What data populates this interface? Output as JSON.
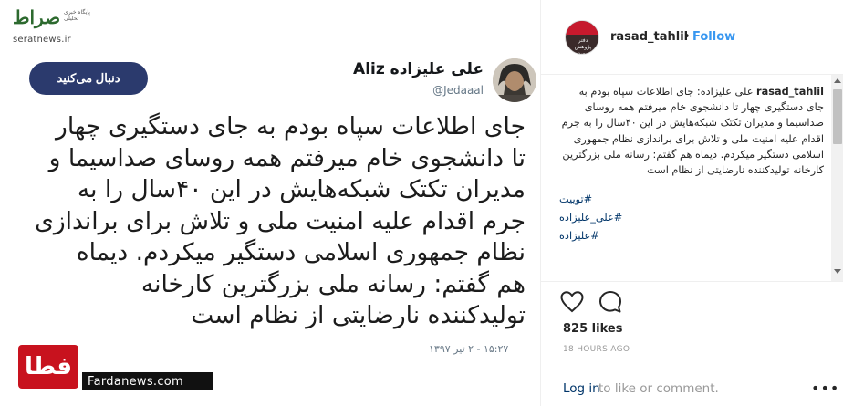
{
  "watermark_top": {
    "logo": "صراط",
    "tagline": "پایگاه خبری تحلیلی",
    "site": "seratnews.ir"
  },
  "tweet": {
    "author_name": "علی علیزاده Aliz",
    "author_handle": "@Jedaaal",
    "follow_label": "دنبال می‌کنید",
    "lines": [
      "جای اطلاعات سپاه بودم به جای دستگیری چهار",
      "تا دانشجوی خام میرفتم همه روسای صداسیما و",
      "مدیران تکتک شبکه‌هایش در این ۴۰سال را به",
      "جرم اقدام علیه امنیت ملی و تلاش برای براندازی",
      "نظام جمهوری اسلامی دستگیر میکردم. دیماه",
      "هم گفتم: رسانه ملی بزرگترین کارخانه",
      "تولیدکننده نارضایتی از نظام است"
    ],
    "date": "۱۵:۲۷ - ۲ تیر ۱۳۹۷"
  },
  "watermark_bottom": {
    "logo": "فطا",
    "site": "Fardanews.com"
  },
  "side": {
    "username": "rasad_tahlil",
    "separator": "•",
    "follow": "Follow",
    "avatar_text": "دفتر پژوهش رصد",
    "caption_user": "rasad_tahlil",
    "caption_text": "علی علیزاده: جای اطلاعات سپاه بودم به جای دستگیری چهار تا دانشجوی خام میرفتم همه روسای صداسیما و مدیران تکتک شبکه‌هایش در این ۴۰سال را به جرم اقدام علیه امنیت ملی و تلاش برای براندازی نظام جمهوری اسلامی دستگیر میکردم. دیماه هم گفتم: رسانه ملی بزرگترین کارخانه تولیدکننده نارضایتی از نظام است",
    "hashtags": [
      "#توییت",
      "#علی_علیزاده",
      "#علیزاده"
    ],
    "likes": "825 likes",
    "time_ago": "18 HOURS AGO",
    "login_link": "Log in",
    "login_rest": "to like or comment.",
    "more": "•••"
  },
  "colors": {
    "follow_blue": "#3897f0",
    "tweet_button": "#2b3a6d",
    "link": "#003569"
  }
}
